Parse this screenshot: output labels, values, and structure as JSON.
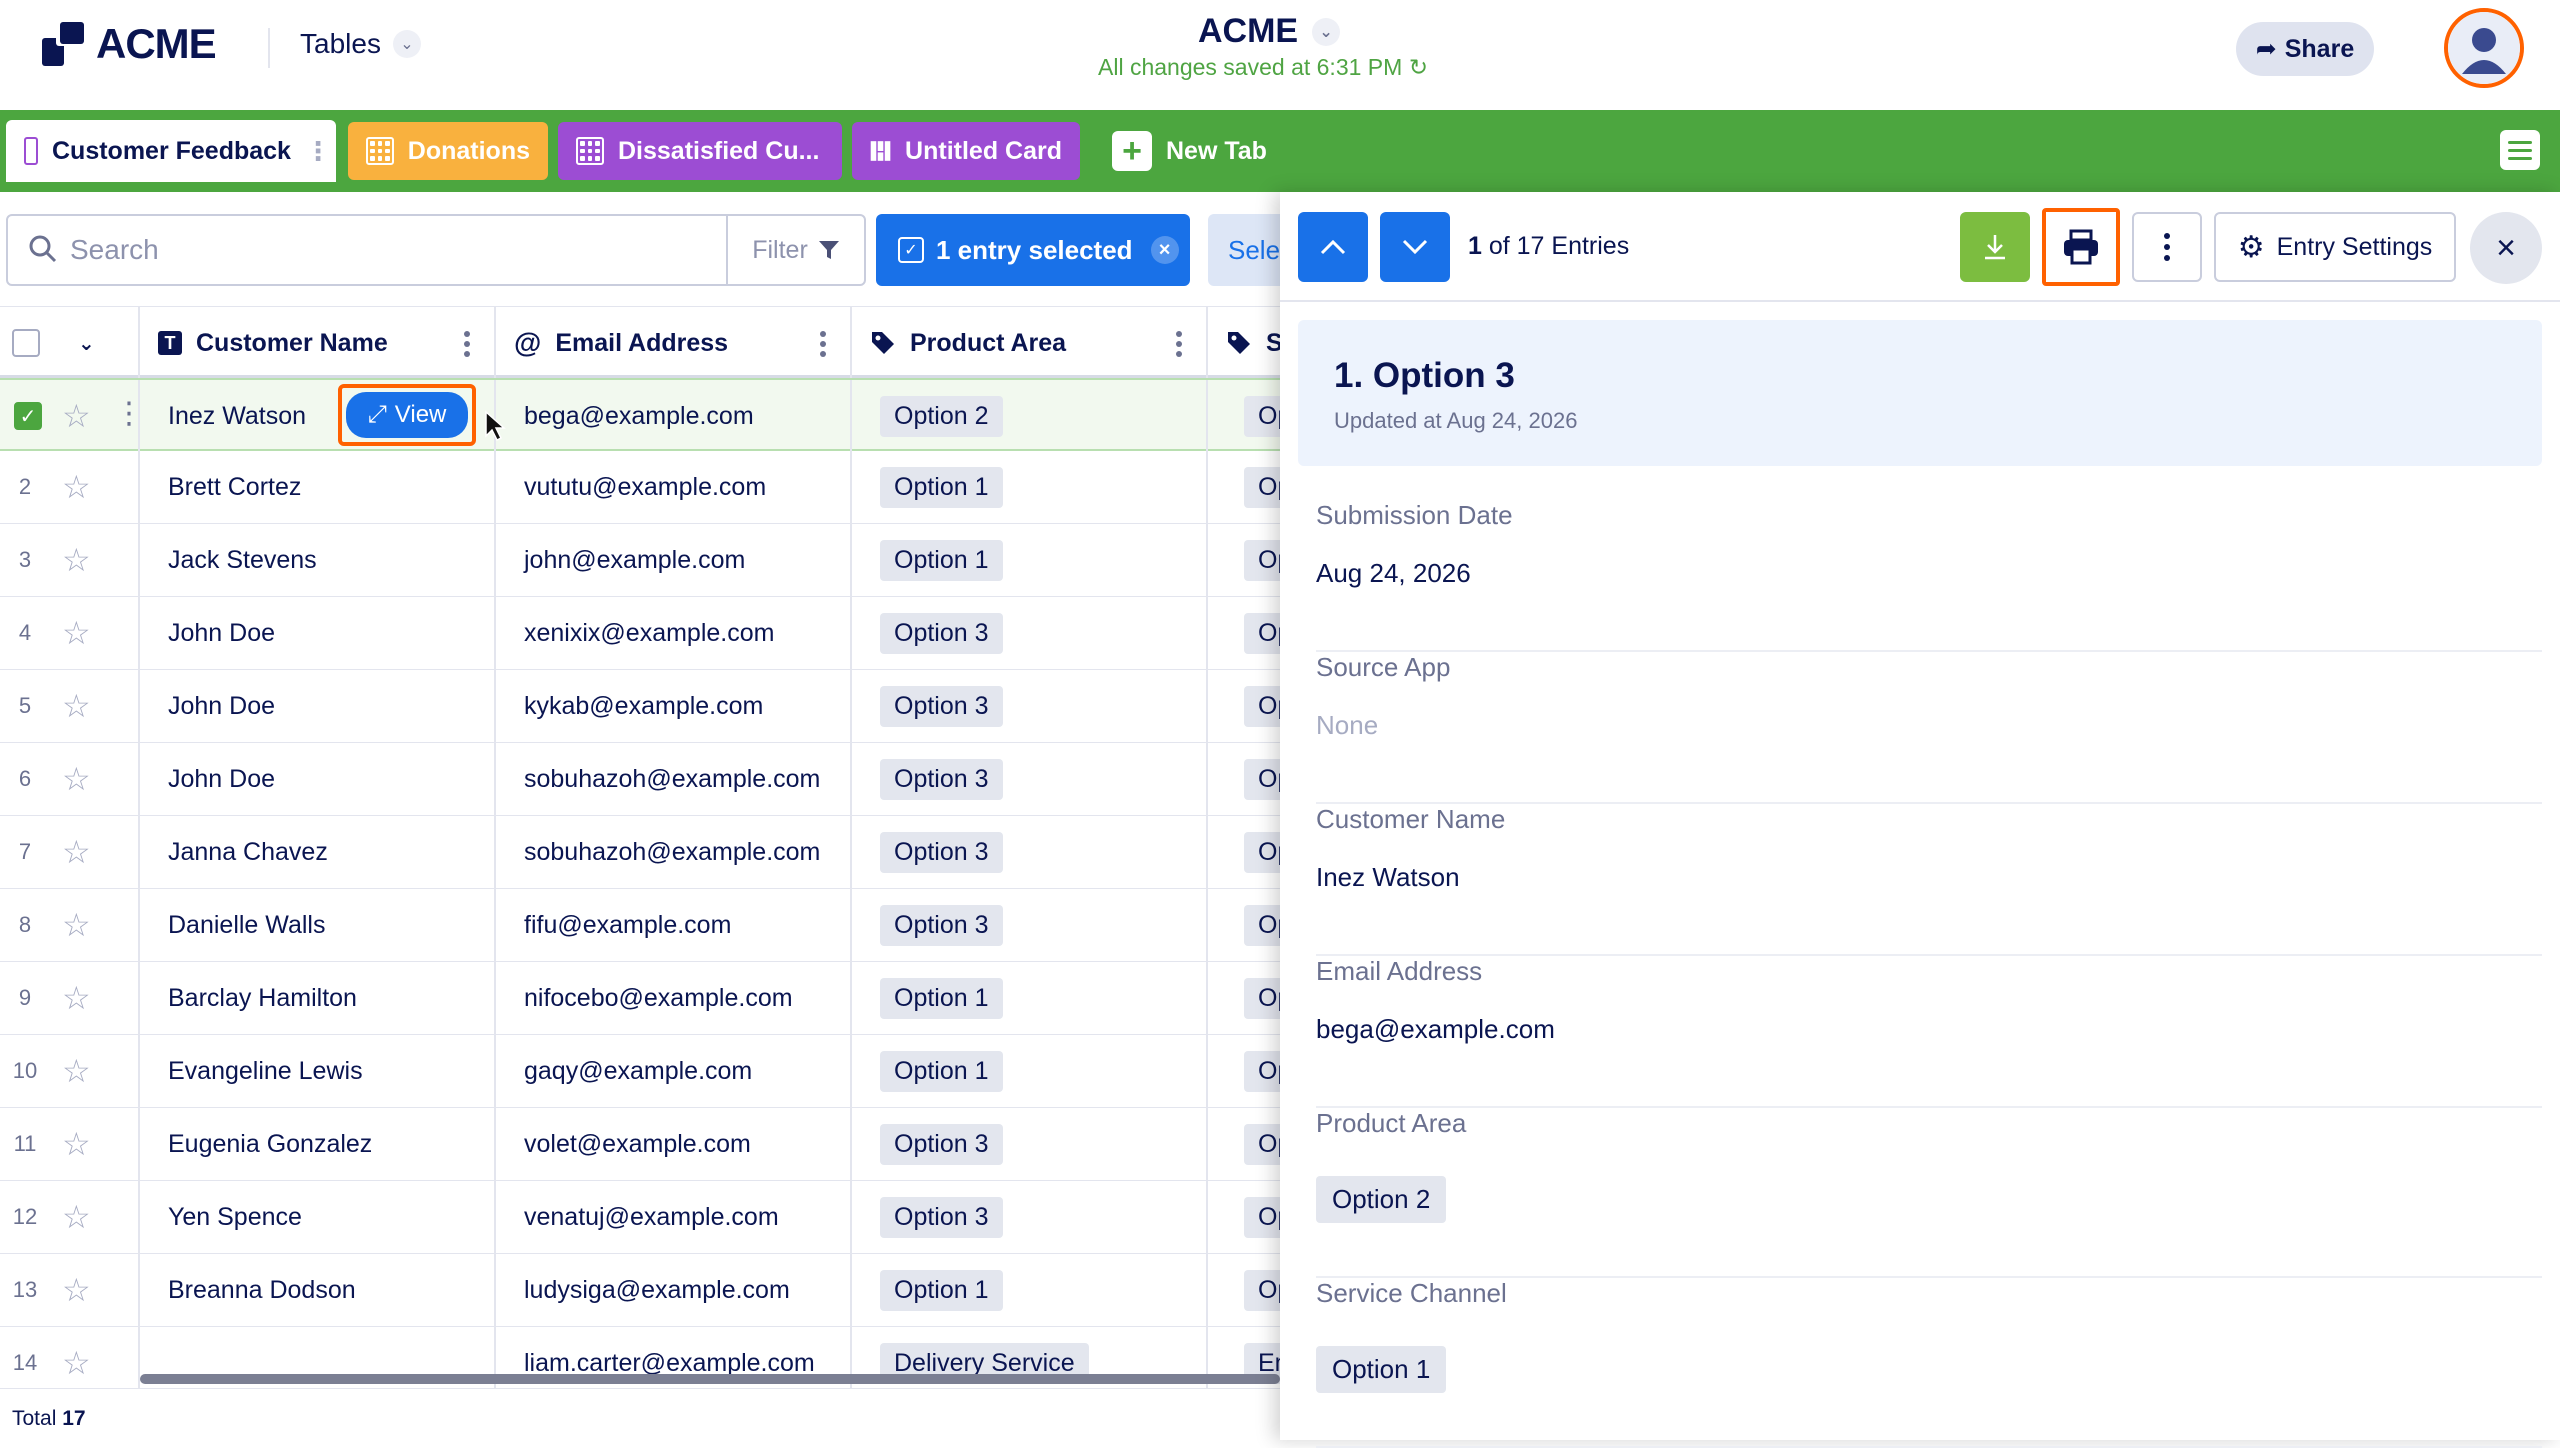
{
  "header": {
    "brand": "ACME",
    "tables_menu": "Tables",
    "app_title": "ACME",
    "save_status": "All changes saved at 6:31 PM",
    "share_label": "Share"
  },
  "tabs": [
    {
      "label": "Customer Feedback",
      "color": "#ffffff",
      "icon": "grid-icon"
    },
    {
      "label": "Donations",
      "color": "#f9b13e",
      "icon": "grid-icon"
    },
    {
      "label": "Dissatisfied Cu...",
      "color": "#9c4dd3",
      "icon": "grid-icon"
    },
    {
      "label": "Untitled Card",
      "color": "#9c4dd3",
      "icon": "card-icon"
    },
    {
      "label": "New Tab",
      "icon": "plus-icon"
    }
  ],
  "toolbar": {
    "search_placeholder": "Search",
    "filter_label": "Filter",
    "selected_label": "1 entry selected",
    "select_label": "Sele"
  },
  "table": {
    "columns": [
      "Customer Name",
      "Email Address",
      "Product Area",
      "S"
    ],
    "view_label": "View",
    "rows": [
      {
        "n": "",
        "name": "Inez Watson",
        "email": "bega@example.com",
        "area": "Option 2",
        "s": "Op"
      },
      {
        "n": "2",
        "name": "Brett Cortez",
        "email": "vututu@example.com",
        "area": "Option 1",
        "s": "Op"
      },
      {
        "n": "3",
        "name": "Jack Stevens",
        "email": "john@example.com",
        "area": "Option 1",
        "s": "Op"
      },
      {
        "n": "4",
        "name": "John Doe",
        "email": "xenixix@example.com",
        "area": "Option 3",
        "s": "Op"
      },
      {
        "n": "5",
        "name": "John Doe",
        "email": "kykab@example.com",
        "area": "Option 3",
        "s": "Op"
      },
      {
        "n": "6",
        "name": "John Doe",
        "email": "sobuhazoh@example.com",
        "area": "Option 3",
        "s": "Op"
      },
      {
        "n": "7",
        "name": "Janna Chavez",
        "email": "sobuhazoh@example.com",
        "area": "Option 3",
        "s": "Op"
      },
      {
        "n": "8",
        "name": "Danielle Walls",
        "email": "fifu@example.com",
        "area": "Option 3",
        "s": "Op"
      },
      {
        "n": "9",
        "name": "Barclay Hamilton",
        "email": "nifocebo@example.com",
        "area": "Option 1",
        "s": "Op"
      },
      {
        "n": "10",
        "name": "Evangeline Lewis",
        "email": "gaqy@example.com",
        "area": "Option 1",
        "s": "Op"
      },
      {
        "n": "11",
        "name": "Eugenia Gonzalez",
        "email": "volet@example.com",
        "area": "Option 3",
        "s": "Op"
      },
      {
        "n": "12",
        "name": "Yen Spence",
        "email": "venatuj@example.com",
        "area": "Option 3",
        "s": "Op"
      },
      {
        "n": "13",
        "name": "Breanna Dodson",
        "email": "ludysiga@example.com",
        "area": "Option 1",
        "s": "Op"
      },
      {
        "n": "14",
        "name": "",
        "email": "liam.carter@example.com",
        "area": "Delivery Service",
        "s": "Em"
      }
    ],
    "total_label": "Total",
    "total_count": "17"
  },
  "panel": {
    "position": "1",
    "entries_suffix": "of 17 Entries",
    "settings_label": "Entry Settings",
    "entry_title": "1. Option 3",
    "entry_updated": "Updated at Aug 24, 2026",
    "fields": [
      {
        "label": "Submission Date",
        "value": "Aug 24, 2026",
        "kind": "text"
      },
      {
        "label": "Source App",
        "value": "None",
        "kind": "muted"
      },
      {
        "label": "Customer Name",
        "value": "Inez Watson",
        "kind": "text"
      },
      {
        "label": "Email Address",
        "value": "bega@example.com",
        "kind": "text"
      },
      {
        "label": "Product Area",
        "value": "Option 2",
        "kind": "pill"
      },
      {
        "label": "Service Channel",
        "value": "Option 1",
        "kind": "pill"
      }
    ]
  },
  "colors": {
    "accent": "#1971e8",
    "tabbar": "#4ca63f",
    "highlight": "#ff6100"
  }
}
